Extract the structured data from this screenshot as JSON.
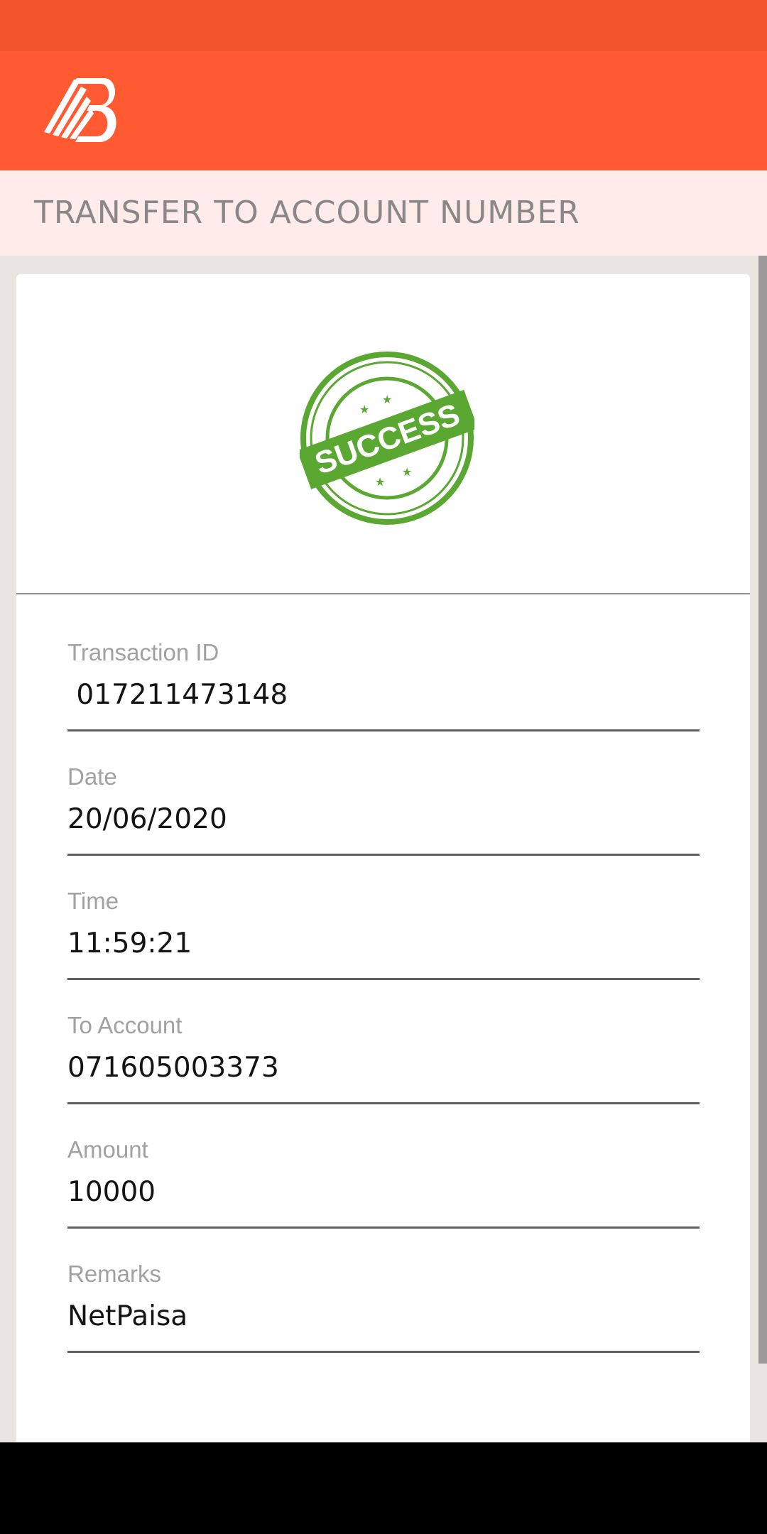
{
  "header": {
    "title": "TRANSFER TO ACCOUNT NUMBER"
  },
  "stamp": {
    "text": "SUCCESS",
    "color": "#5aa731"
  },
  "colors": {
    "status_bar": "#f4542d",
    "app_bar": "#ff5a32",
    "title_band": "#ffecea"
  },
  "fields": [
    {
      "label": "Transaction ID",
      "value": " 017211473148"
    },
    {
      "label": "Date",
      "value": "20/06/2020"
    },
    {
      "label": "Time",
      "value": "11:59:21"
    },
    {
      "label": "To Account",
      "value": "071605003373"
    },
    {
      "label": "Amount",
      "value": "10000"
    },
    {
      "label": "Remarks",
      "value": "NetPaisa"
    }
  ]
}
